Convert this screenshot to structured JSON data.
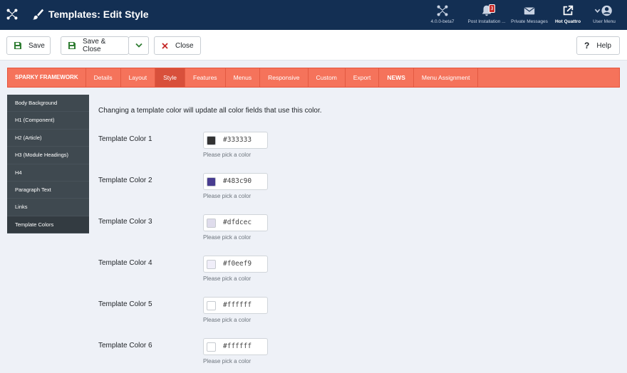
{
  "header": {
    "title": "Templates: Edit Style",
    "items": [
      {
        "label": "4.0.0-beta7",
        "icon": "joomla-icon"
      },
      {
        "label": "Post Installation ...",
        "icon": "bell-icon",
        "badge": "3"
      },
      {
        "label": "Private Messages",
        "icon": "envelope-icon"
      },
      {
        "label": "Hot Quattro",
        "icon": "external-link-icon"
      },
      {
        "label": "User Menu",
        "icon": "user-icon"
      }
    ]
  },
  "toolbar": {
    "save_label": "Save",
    "save_close_label": "Save & Close",
    "close_label": "Close",
    "help_label": "Help"
  },
  "tabs": [
    "SPARKY FRAMEWORK",
    "Details",
    "Layout",
    "Style",
    "Features",
    "Menus",
    "Responsive",
    "Custom",
    "Export",
    "NEWS",
    "Menu Assignment"
  ],
  "active_tab": "Style",
  "sidebar": {
    "items": [
      "Body Background",
      "H1 (Component)",
      "H2 (Article)",
      "H3 (Module Headings)",
      "H4",
      "Paragraph Text",
      "Links",
      "Template Colors"
    ],
    "active": "Template Colors"
  },
  "content": {
    "intro": "Changing a template color will update all color fields that use this color.",
    "hint": "Please pick a color",
    "colors": [
      {
        "label": "Template Color 1",
        "value": "#333333"
      },
      {
        "label": "Template Color 2",
        "value": "#483c90"
      },
      {
        "label": "Template Color 3",
        "value": "#dfdcec"
      },
      {
        "label": "Template Color 4",
        "value": "#f0eef9"
      },
      {
        "label": "Template Color 5",
        "value": "#ffffff"
      },
      {
        "label": "Template Color 6",
        "value": "#ffffff"
      }
    ]
  },
  "colors": {
    "header_bg": "#132f53",
    "tab_bar": "#f5735b",
    "tab_active": "#d8503b",
    "sidebar_bg": "#3f4950"
  }
}
